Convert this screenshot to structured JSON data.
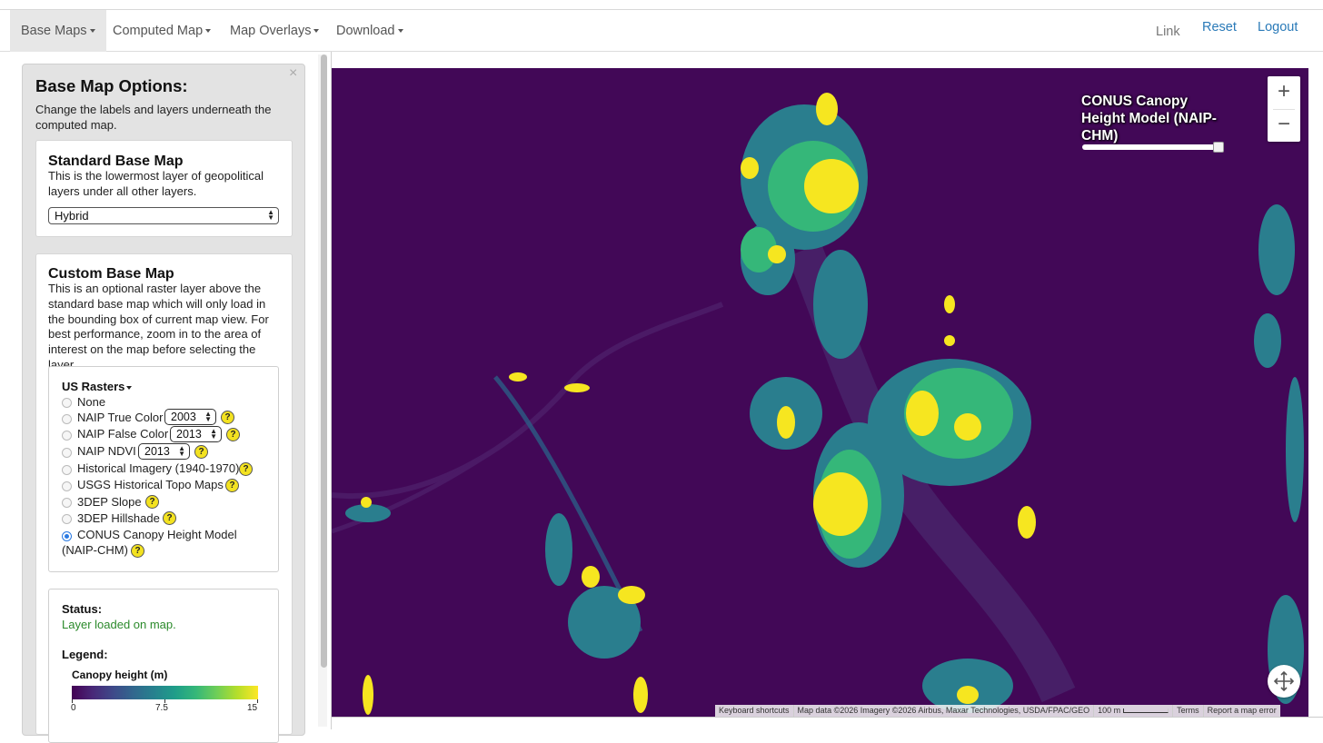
{
  "navbar": {
    "menus": [
      "Base Maps",
      "Computed Map",
      "Map Overlays",
      "Download"
    ],
    "right": {
      "link": "Link",
      "reset": "Reset",
      "logout": "Logout"
    }
  },
  "panel": {
    "close_glyph": "×",
    "title": "Base Map Options:",
    "description": "Change the labels and layers underneath the computed map.",
    "standard": {
      "title": "Standard Base Map",
      "description": "This is the lowermost layer of geopolitical layers under all other layers.",
      "selected": "Hybrid"
    },
    "custom": {
      "title": "Custom Base Map",
      "description": "This is an optional raster layer above the standard base map which will only load in the bounding box of current map view. For best performance, zoom in to the area of interest on the map before selecting the layer.",
      "rasters_menu": "US Rasters",
      "options": {
        "none": "None",
        "naip_true": "NAIP True Color",
        "naip_true_year": "2003",
        "naip_false": "NAIP False Color",
        "naip_false_year": "2013",
        "naip_ndvi": "NAIP NDVI",
        "naip_ndvi_year": "2013",
        "historical": "Historical Imagery (1940-1970)",
        "usgs_topo": "USGS Historical Topo Maps",
        "slope": "3DEP Slope",
        "hillshade": "3DEP Hillshade",
        "chm_line1": "CONUS Canopy Height Model",
        "chm_line2": "(NAIP-CHM)"
      },
      "selected_option": "CONUS Canopy Height Model (NAIP-CHM)",
      "help_glyph": "?"
    },
    "status": {
      "label": "Status:",
      "text": "Layer loaded on map.",
      "legend_label": "Legend:",
      "legend_title": "Canopy height (m)",
      "ticks": [
        "0",
        "7.5",
        "15"
      ],
      "colormap": [
        "#440154",
        "#3e4989",
        "#26828e",
        "#35b779",
        "#fde725"
      ]
    }
  },
  "map": {
    "layer_title": "CONUS Canopy Height Model (NAIP-CHM)",
    "opacity": 1.0,
    "zoom_in": "+",
    "zoom_out": "−",
    "attribution": {
      "shortcuts": "Keyboard shortcuts",
      "data": "Map data ©2026 Imagery ©2026 Airbus, Maxar Technologies, USDA/FPAC/GEO",
      "scale": "100 m",
      "terms": "Terms",
      "report": "Report a map error"
    },
    "colors": {
      "background": "#420857",
      "low": "#2a6e8e",
      "mid": "#35b779",
      "high": "#f6e620"
    }
  }
}
